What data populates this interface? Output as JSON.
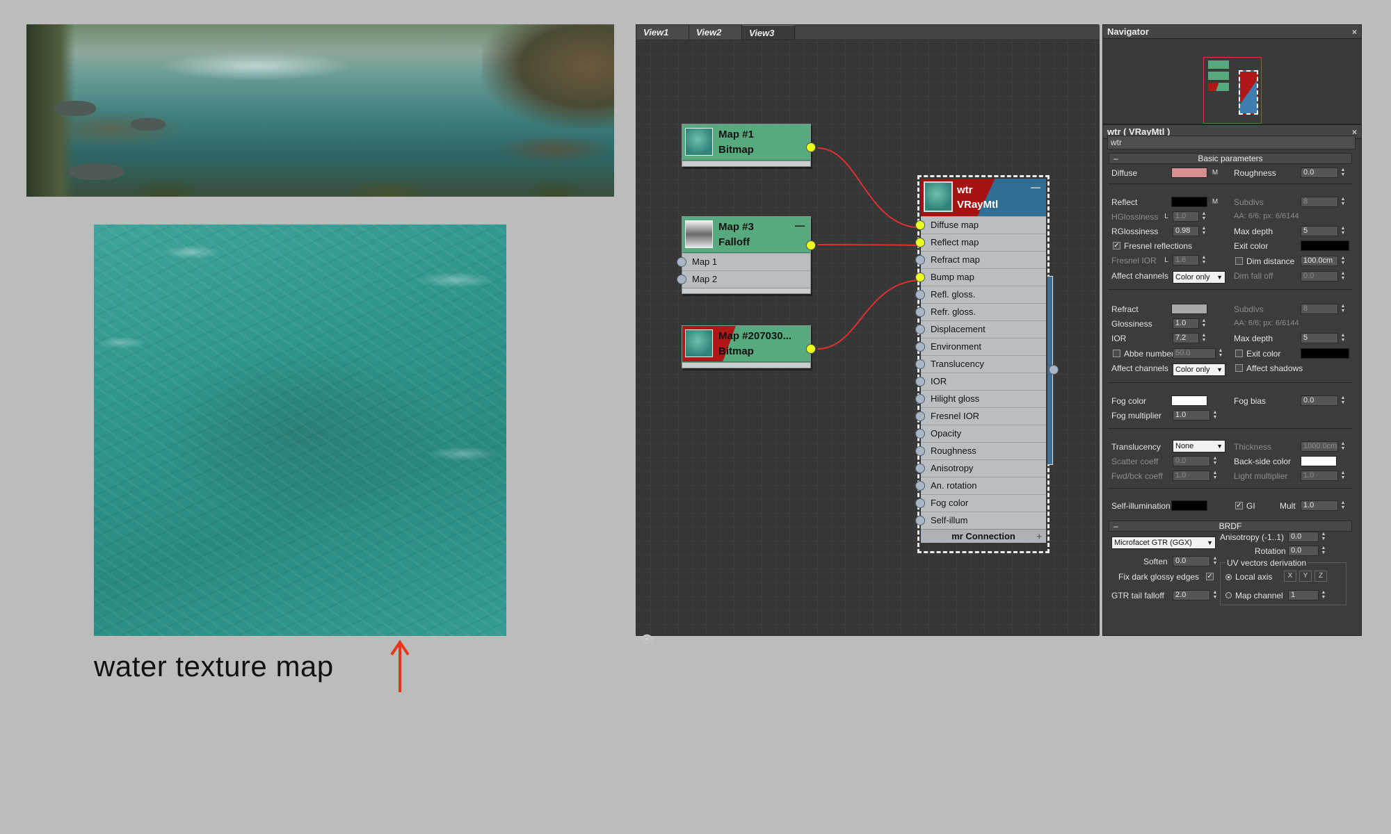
{
  "caption": "water texture map",
  "editor": {
    "tabs": [
      "View1",
      "View2",
      "View3"
    ],
    "nodes": {
      "map1": {
        "name": "Map #1",
        "type": "Bitmap"
      },
      "map3": {
        "name": "Map #3",
        "type": "Falloff",
        "slots": [
          "Map 1",
          "Map 2"
        ],
        "min": "—"
      },
      "map207": {
        "name": "Map #207030...",
        "type": "Bitmap"
      }
    },
    "wtr": {
      "name": "wtr",
      "type": "VRayMtl",
      "min": "—",
      "slots": [
        "Diffuse map",
        "Reflect map",
        "Refract map",
        "Bump map",
        "Refl. gloss.",
        "Refr. gloss.",
        "Displacement",
        "Environment",
        "Translucency",
        "IOR",
        "Hilight gloss",
        "Fresnel IOR",
        "Opacity",
        "Roughness",
        "Anisotropy",
        "An. rotation",
        "Fog color",
        "Self-illum"
      ],
      "connected": [
        0,
        1,
        3
      ],
      "footer": "mr Connection",
      "footer_plus": "+"
    },
    "binoculars": "binoculars-icon"
  },
  "navigator": {
    "title": "Navigator",
    "close": "×"
  },
  "material": {
    "title": "wtr  ( VRayMtl )",
    "close": "×",
    "name": "wtr",
    "basic": {
      "rollout": "Basic parameters",
      "minus": "–",
      "diffuse": "Diffuse",
      "m": "M",
      "roughness": "Roughness",
      "roughness_val": "0.0",
      "reflect": "Reflect",
      "subdivs": "Subdivs",
      "subdivs_val": "8",
      "hgloss": "HGlossiness",
      "hgloss_l": "L",
      "hgloss_val": "1.0",
      "aa": "AA: 6/6; px: 6/6144",
      "rgloss": "RGlossiness",
      "rgloss_val": "0.98",
      "maxdepth": "Max depth",
      "maxdepth_val": "5",
      "fresnel": "Fresnel reflections",
      "exitcolor": "Exit color",
      "fresnel_ior": "Fresnel IOR",
      "fresnel_ior_l": "L",
      "fresnel_ior_val": "1.6",
      "dimdist": "Dim distance",
      "dimdist_val": "100.0cm",
      "affect": "Affect channels",
      "affect_val": "Color only",
      "dimfall": "Dim fall off",
      "dimfall_val": "0.0",
      "refract": "Refract",
      "r_subdivs": "Subdivs",
      "r_subdivs_val": "8",
      "glossiness": "Glossiness",
      "glossiness_val": "1.0",
      "r_aa": "AA: 6/6; px: 6/6144",
      "ior": "IOR",
      "ior_val": "7.2",
      "r_maxdepth": "Max depth",
      "r_maxdepth_val": "5",
      "abbe": "Abbe number",
      "abbe_val": "50.0",
      "r_exitcolor": "Exit color",
      "r_affect": "Affect channels",
      "r_affect_val": "Color only",
      "affect_shadows": "Affect shadows",
      "fogcolor": "Fog color",
      "fogbias": "Fog bias",
      "fogbias_val": "0.0",
      "fogmult": "Fog multiplier",
      "fogmult_val": "1.0",
      "translucency": "Translucency",
      "translucency_val": "None",
      "thickness": "Thickness",
      "thickness_val": "1000.0cm",
      "scatter": "Scatter coeff",
      "scatter_val": "0.0",
      "backside": "Back-side color",
      "fwdbck": "Fwd/bck coeff",
      "fwdbck_val": "1.0",
      "lightmult": "Light multiplier",
      "lightmult_val": "1.0",
      "selfillum": "Self-illumination",
      "gi": "GI",
      "mult": "Mult",
      "mult_val": "1.0"
    },
    "brdf": {
      "rollout": "BRDF",
      "minus": "–",
      "type": "Microfacet GTR (GGX)",
      "anisotropy": "Anisotropy (-1..1)",
      "anisotropy_val": "0.0",
      "rotation": "Rotation",
      "rotation_val": "0.0",
      "soften": "Soften",
      "soften_val": "0.0",
      "uvderiv": "UV vectors derivation",
      "fixdark": "Fix dark glossy edges",
      "localaxis": "Local axis",
      "x": "X",
      "y": "Y",
      "z": "Z",
      "gtr": "GTR tail falloff",
      "gtr_val": "2.0",
      "mapchannel": "Map channel",
      "mapchannel_val": "1"
    },
    "colors": {
      "diffuse": "#d88f8f",
      "reflect": "#000000",
      "refract": "#a8a8a8",
      "fog": "#ffffff",
      "backside": "#ffffff",
      "selfillum": "#000000",
      "exit": "#000000"
    }
  },
  "colors": {
    "wire": "#e03030",
    "socket_on": "#e9ff1e",
    "node_green": "#57aa7d",
    "arrow": "#e8351c"
  }
}
